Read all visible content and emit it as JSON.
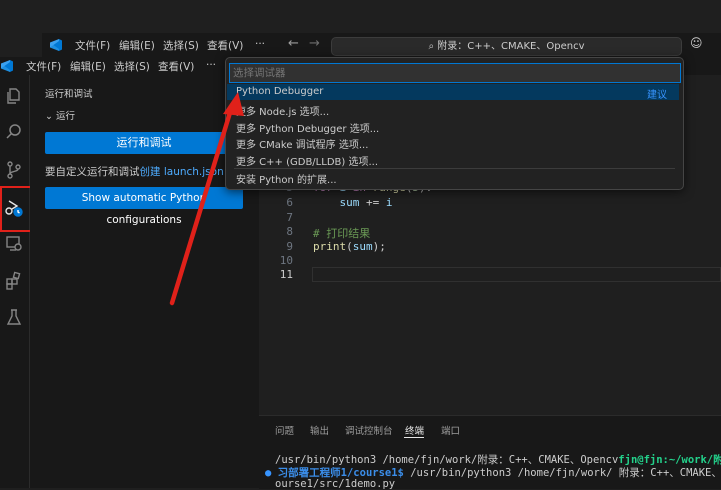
{
  "ghost_window": {
    "menu": [
      "文件(F)",
      "编辑(E)",
      "选择(S)",
      "查看(V)",
      "···"
    ],
    "search": "附录：C++、CMAKE、Opencv"
  },
  "titlebar": {
    "menu": [
      "文件(F)",
      "编辑(E)",
      "选择(S)",
      "查看(V)",
      "···"
    ]
  },
  "activity_bar": {
    "icons": [
      "explorer-icon",
      "search-icon",
      "source-control-icon",
      "run-debug-icon",
      "remote-explorer-icon",
      "extensions-icon",
      "testing-icon"
    ]
  },
  "sidebar": {
    "title": "运行和调试",
    "section": "运行",
    "run_button": "运行和调试",
    "customize_text": "要自定义运行和调试",
    "customize_link": "创建 launch.json 文件",
    "python_config_button": "Show automatic Python configurations"
  },
  "editor": {
    "lines": [
      {
        "num": "5",
        "code": "for i in range(5):"
      },
      {
        "num": "6",
        "code": "    sum += i"
      },
      {
        "num": "7",
        "code": ""
      },
      {
        "num": "8",
        "code": "# 打印结果"
      },
      {
        "num": "9",
        "code": "print(sum);"
      },
      {
        "num": "10",
        "code": ""
      },
      {
        "num": "11",
        "code": ""
      }
    ]
  },
  "panel": {
    "tabs": [
      "问题",
      "输出",
      "调试控制台",
      "终端",
      "端口"
    ],
    "active_tab": "终端",
    "terminal": {
      "line1_cmd": "/usr/bin/python3 /home/fjn/work/附录：C++、CMAKE、Opencv",
      "line1_prompt": "fjn@fjn:~/work/附录",
      "line2_prompt": "习部署工程师1/course1$",
      "line2_cmd": " /usr/bin/python3 /home/fjn/work/ 附录：C++、CMAKE、",
      "line3": "ourse1/src/1demo.py"
    }
  },
  "quick_pick": {
    "placeholder": "选择调试器",
    "items": [
      {
        "label": "Python Debugger",
        "tag": "建议"
      },
      {
        "label": "更多 Node.js 选项..."
      },
      {
        "label": "更多 Python Debugger 选项..."
      },
      {
        "label": "更多 CMake 调试程序 选项..."
      },
      {
        "label": "更多 C++ (GDB/LLDB) 选项..."
      },
      {
        "label": "安装 Python 的扩展..."
      }
    ]
  },
  "colors": {
    "accent": "#0078d4",
    "annotation": "#e0211a",
    "link": "#4daafc"
  }
}
